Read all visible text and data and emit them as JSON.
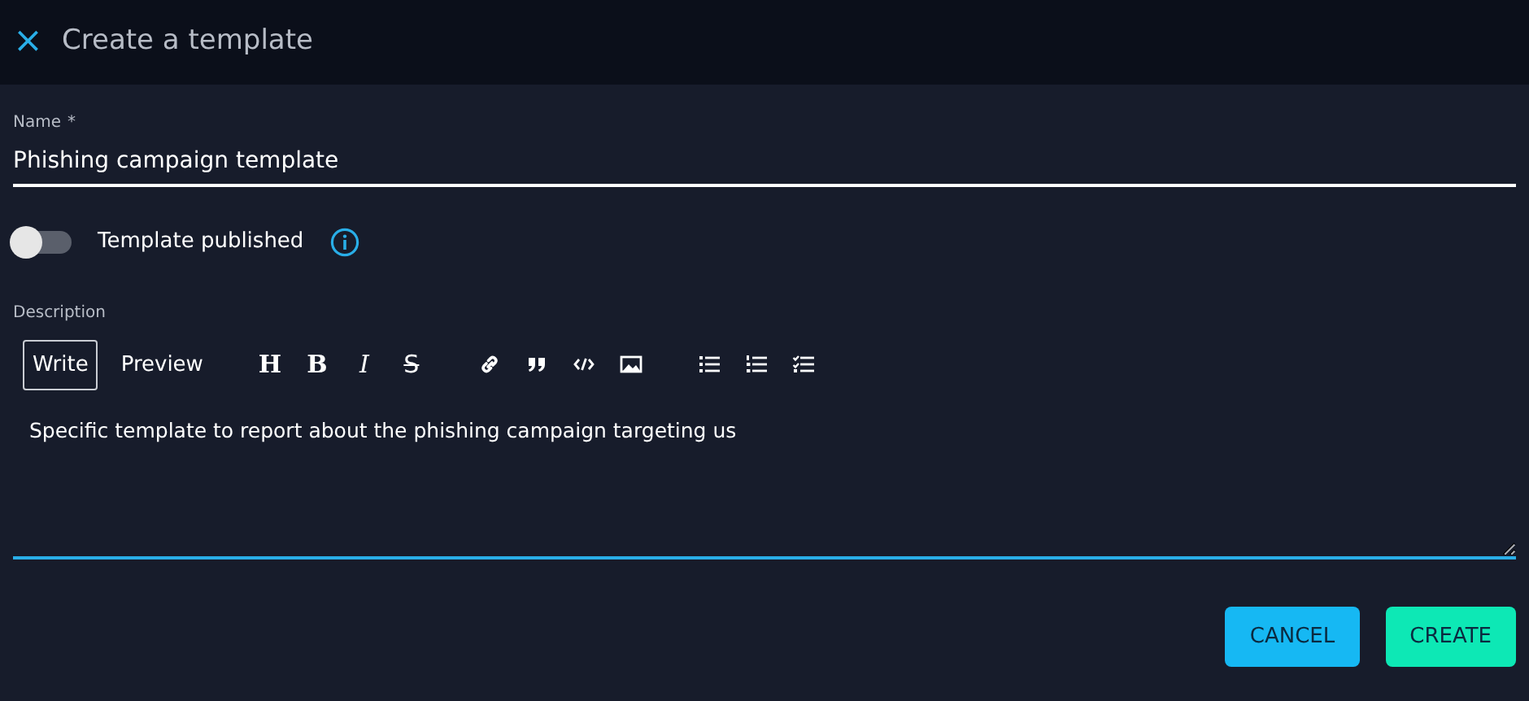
{
  "header": {
    "close": "×",
    "title": "Create a template"
  },
  "name_field": {
    "label": "Name",
    "required_mark": "*",
    "value": "Phishing campaign template"
  },
  "published": {
    "label": "Template published",
    "on": false
  },
  "description": {
    "label": "Description",
    "tabs": [
      {
        "label": "Write",
        "selected": true
      },
      {
        "label": "Preview",
        "selected": false
      }
    ],
    "toolbar": [
      [
        {
          "kind": "heading",
          "label": "H"
        },
        {
          "kind": "bold",
          "label": "B"
        },
        {
          "kind": "italic",
          "label": "I"
        },
        {
          "kind": "strike",
          "label": "S"
        }
      ],
      [
        {
          "kind": "link"
        },
        {
          "kind": "quote"
        },
        {
          "kind": "code"
        },
        {
          "kind": "image"
        }
      ],
      [
        {
          "kind": "bullets"
        },
        {
          "kind": "numbers"
        },
        {
          "kind": "tasks"
        }
      ]
    ],
    "value": "Specific template to report about the phishing campaign targeting us"
  },
  "buttons": [
    {
      "label": "CANCEL",
      "kind": "cancel"
    },
    {
      "label": "CREATE",
      "kind": "create"
    }
  ]
}
